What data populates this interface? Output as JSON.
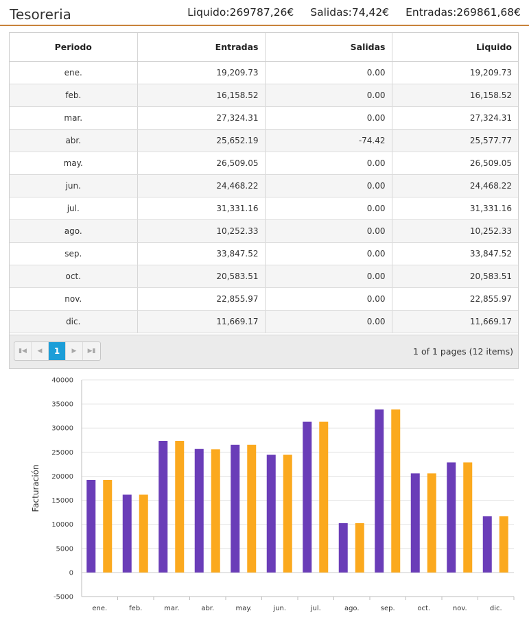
{
  "header": {
    "title": "Tesoreria",
    "liquido": "Liquido:269787,26€",
    "salidas": "Salidas:74,42€",
    "entradas": "Entradas:269861,68€"
  },
  "table": {
    "columns": [
      "Periodo",
      "Entradas",
      "Salidas",
      "Liquido"
    ],
    "rows": [
      [
        "ene.",
        "19,209.73",
        "0.00",
        "19,209.73"
      ],
      [
        "feb.",
        "16,158.52",
        "0.00",
        "16,158.52"
      ],
      [
        "mar.",
        "27,324.31",
        "0.00",
        "27,324.31"
      ],
      [
        "abr.",
        "25,652.19",
        "-74.42",
        "25,577.77"
      ],
      [
        "may.",
        "26,509.05",
        "0.00",
        "26,509.05"
      ],
      [
        "jun.",
        "24,468.22",
        "0.00",
        "24,468.22"
      ],
      [
        "jul.",
        "31,331.16",
        "0.00",
        "31,331.16"
      ],
      [
        "ago.",
        "10,252.33",
        "0.00",
        "10,252.33"
      ],
      [
        "sep.",
        "33,847.52",
        "0.00",
        "33,847.52"
      ],
      [
        "oct.",
        "20,583.51",
        "0.00",
        "20,583.51"
      ],
      [
        "nov.",
        "22,855.97",
        "0.00",
        "22,855.97"
      ],
      [
        "dic.",
        "11,669.17",
        "0.00",
        "11,669.17"
      ]
    ]
  },
  "pager": {
    "first_icon": "first-page-icon",
    "prev_icon": "prev-page-icon",
    "current_page": "1",
    "next_icon": "next-page-icon",
    "last_icon": "last-page-icon",
    "info": "1 of 1 pages (12 items)"
  },
  "colors": {
    "header_line": "#c8823a",
    "series_1": "#6a3db8",
    "series_2": "#fba91e",
    "pager_active": "#1c9ed8"
  },
  "chart_data": {
    "type": "bar",
    "categories": [
      "ene.",
      "feb.",
      "mar.",
      "abr.",
      "may.",
      "jun.",
      "jul.",
      "ago.",
      "sep.",
      "oct.",
      "nov.",
      "dic."
    ],
    "series": [
      {
        "values": [
          19209.73,
          16158.52,
          27324.31,
          25652.19,
          26509.05,
          24468.22,
          31331.16,
          10252.33,
          33847.52,
          20583.51,
          22855.97,
          11669.17
        ]
      },
      {
        "values": [
          19209.73,
          16158.52,
          27324.31,
          25577.77,
          26509.05,
          24468.22,
          31331.16,
          10252.33,
          33847.52,
          20583.51,
          22855.97,
          11669.17
        ]
      }
    ],
    "title": "",
    "xlabel": "",
    "ylabel": "Facturación",
    "ylim": [
      -5000,
      40000
    ],
    "yticks": [
      40000,
      35000,
      30000,
      25000,
      20000,
      15000,
      10000,
      5000,
      0,
      -5000
    ],
    "grid": true,
    "legend": "none"
  }
}
